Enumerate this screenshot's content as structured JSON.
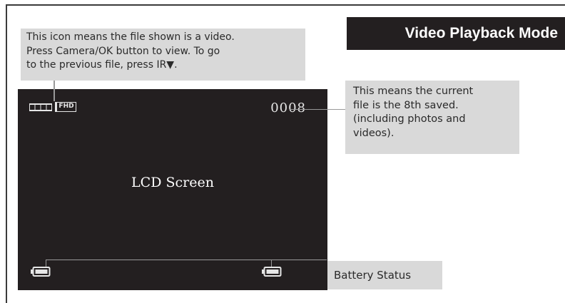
{
  "header": {
    "title": "Video Playback Mode"
  },
  "callouts": {
    "video_icon": {
      "line1": "This icon means the file shown is a video.",
      "line2": "Press Camera/OK button  to view. To go",
      "line3": "to the previous file, press IR▼."
    },
    "file_number": {
      "line1": "This means the current",
      "line2": "file is the 8th saved.",
      "line3": "(including photos and",
      "line4": "videos)."
    },
    "battery": {
      "label": "Battery Status"
    }
  },
  "lcd": {
    "label": "LCD Screen",
    "file_counter": "0008",
    "resolution_badge": "FHD",
    "icons": [
      "film-strip-icon",
      "fhd-icon",
      "battery-icon",
      "battery-icon"
    ]
  },
  "colors": {
    "screen_bg": "#231f20",
    "callout_bg": "#d9d9d9",
    "title_bg": "#231f20",
    "leader_line": "#999999"
  }
}
